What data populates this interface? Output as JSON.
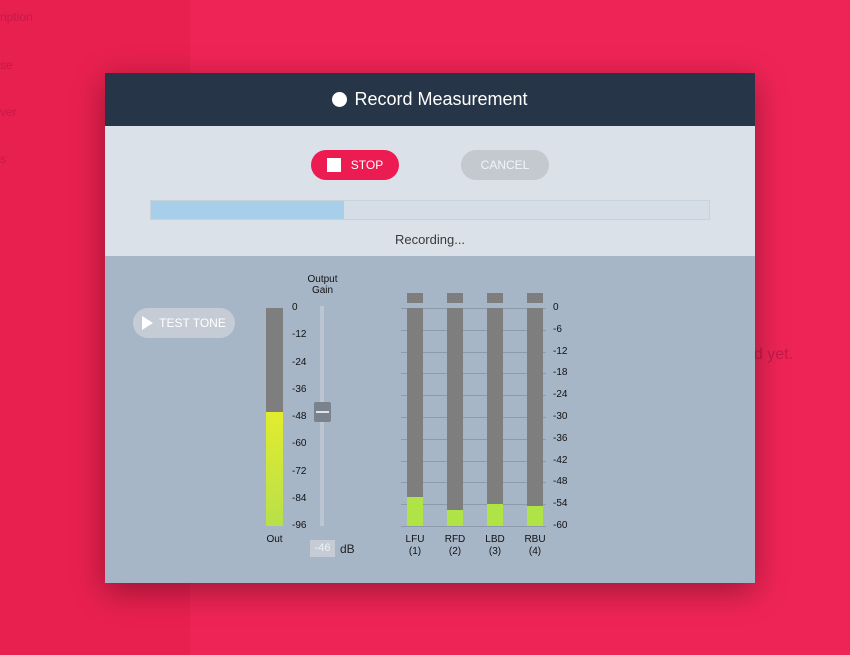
{
  "background": {
    "left_texts": [
      "ription",
      "se",
      "ver",
      "s"
    ],
    "message": "ed yet."
  },
  "dialog": {
    "title": "Record Measurement",
    "stop_label": "STOP",
    "cancel_label": "CANCEL",
    "progress_fraction": 0.345,
    "status": "Recording...",
    "test_tone_label": "TEST TONE"
  },
  "output_meter": {
    "scale_ticks": [
      "0",
      "-12",
      "-24",
      "-36",
      "-48",
      "-60",
      "-72",
      "-84",
      "-96"
    ],
    "level_db": -46,
    "label": "Out"
  },
  "output_gain": {
    "title": "Output Gain",
    "value": "-46",
    "unit": "dB",
    "slider_fraction": 0.48
  },
  "channel_meters": {
    "scale_ticks": [
      "0",
      "-6",
      "-12",
      "-18",
      "-24",
      "-30",
      "-36",
      "-42",
      "-48",
      "-54",
      "-60"
    ],
    "channels": [
      {
        "name": "LFU",
        "num": "(1)",
        "level_db": -52
      },
      {
        "name": "RFD",
        "num": "(2)",
        "level_db": -55.5
      },
      {
        "name": "LBD",
        "num": "(3)",
        "level_db": -54
      },
      {
        "name": "RBU",
        "num": "(4)",
        "level_db": -54.5
      }
    ]
  },
  "colors": {
    "accent": "#ec1b52",
    "header": "#263548",
    "meter_level": "#b0e346",
    "meter_empty": "#7e7e7e"
  }
}
